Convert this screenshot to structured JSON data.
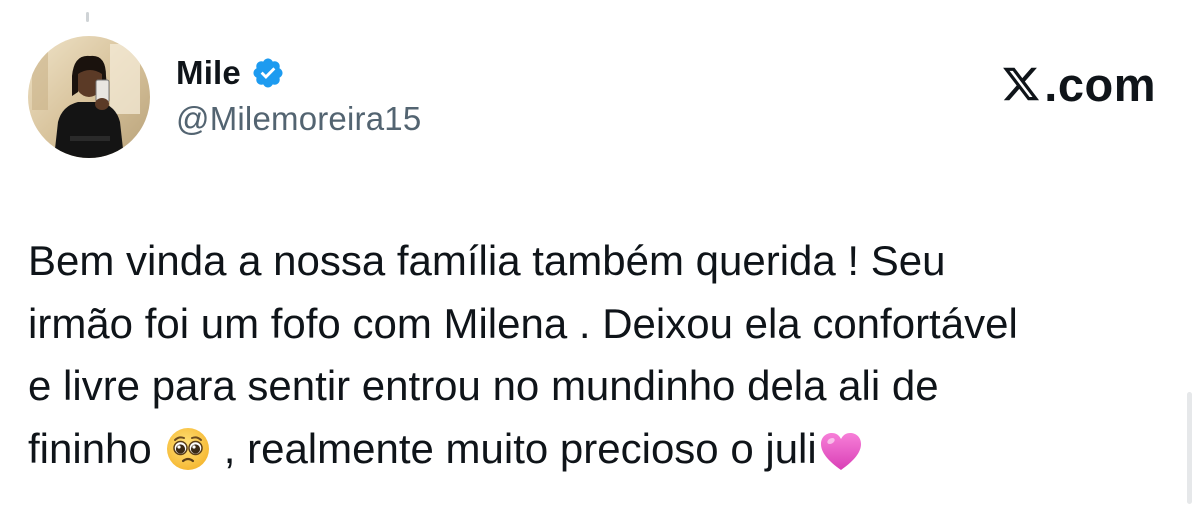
{
  "author": {
    "display_name": "Mile",
    "handle": "@Milemoreira15",
    "verified": true,
    "verified_color": "#1d9bf0"
  },
  "brand": {
    "domain": ".com",
    "logo_icon": "x-logo-icon"
  },
  "tweet": {
    "lines": [
      "Bem vinda a nossa família também querida ! Seu",
      "irmão foi um fofo com Milena . Deixou ela confortável",
      "e livre para sentir entrou no mundinho dela ali de",
      "fininho"
    ],
    "line4_after_emoji": ", realmente muito precioso o juli",
    "emojis": [
      "pleading-face-emoji",
      "pink-heart-emoji"
    ]
  },
  "colors": {
    "text": "#0f1419",
    "handle": "#536471",
    "heart": "#e455c5"
  }
}
